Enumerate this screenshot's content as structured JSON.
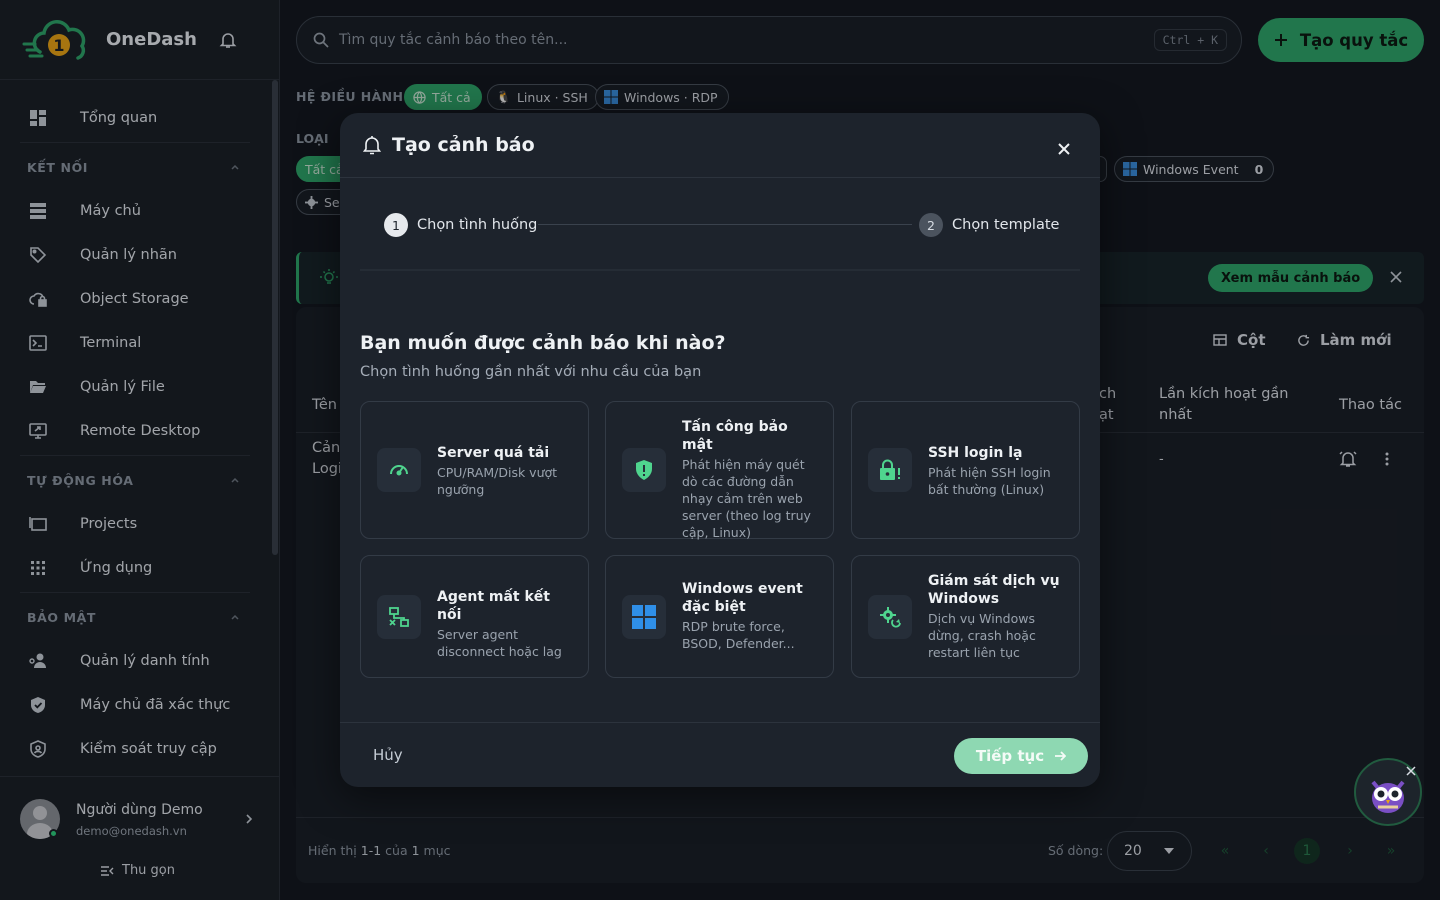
{
  "app": {
    "name": "OneDash"
  },
  "sidebar": {
    "top_item": "Tổng quan",
    "sections": [
      {
        "title": "KẾT NỐI",
        "items": [
          "Máy chủ",
          "Quản lý nhãn",
          "Object Storage",
          "Terminal",
          "Quản lý File",
          "Remote Desktop"
        ]
      },
      {
        "title": "TỰ ĐỘNG HÓA",
        "items": [
          "Projects",
          "Ứng dụng"
        ]
      },
      {
        "title": "BẢO MẬT",
        "items": [
          "Quản lý danh tính",
          "Máy chủ đã xác thực",
          "Kiểm soát truy cập"
        ]
      }
    ],
    "user": {
      "name": "Người dùng Demo",
      "email": "demo@onedash.vn"
    },
    "collapse_label": "Thu gọn"
  },
  "main": {
    "search_placeholder": "Tìm quy tắc cảnh báo theo tên...",
    "search_shortcut": "Ctrl + K",
    "create_button": "Tạo quy tắc",
    "os_filter": {
      "label": "HỆ ĐIỀU HÀNH",
      "chips": [
        "Tất cả",
        "Linux · SSH",
        "Windows · RDP"
      ]
    },
    "type_filter": {
      "label": "LOẠI",
      "chip_all": "Tất cả",
      "chip_partial": "Ser",
      "chip_windows_event": "Windows Event",
      "chip_windows_event_count": "0"
    },
    "tip": {
      "button": "Xem mẫu cảnh báo"
    },
    "toolbar": {
      "columns": "Cột",
      "refresh": "Làm mới"
    },
    "table": {
      "headers": {
        "name": "Tên",
        "partial_1": "ch",
        "partial_2": "ạt",
        "last_triggered_1": "Lần kích hoạt gần",
        "last_triggered_2": "nhất",
        "actions": "Thao tác"
      },
      "row": {
        "name_1": "Cản",
        "name_2": "Logi",
        "last_triggered": "-"
      }
    },
    "footer": {
      "showing_prefix": "Hiển thị",
      "showing_range": "1-1",
      "showing_of": "của",
      "showing_count": "1",
      "showing_suffix": "mục",
      "rows_label": "Số dòng:",
      "rows_value": "20",
      "current_page": "1"
    }
  },
  "modal": {
    "title": "Tạo cảnh báo",
    "steps": [
      {
        "num": "1",
        "label": "Chọn tình huống"
      },
      {
        "num": "2",
        "label": "Chọn template"
      }
    ],
    "question": "Bạn muốn được cảnh báo khi nào?",
    "question_sub": "Chọn tình huống gần nhất với nhu cầu của bạn",
    "cards": [
      {
        "title": "Server quá tải",
        "desc": "CPU/RAM/Disk vượt ngưỡng",
        "icon": "gauge-icon"
      },
      {
        "title": "Tấn công bảo mật",
        "desc": "Phát hiện máy quét dò các đường dẫn nhạy cảm trên web server (theo log truy cập, Linux)",
        "icon": "shield-alert-icon"
      },
      {
        "title": "SSH login lạ",
        "desc": "Phát hiện SSH login bất thường (Linux)",
        "icon": "lock-alert-icon"
      },
      {
        "title": "Agent mất kết nối",
        "desc": "Server agent disconnect hoặc lag",
        "icon": "network-off-icon"
      },
      {
        "title": "Windows event đặc biệt",
        "desc": "RDP brute force, BSOD, Defender...",
        "icon": "windows-icon"
      },
      {
        "title": "Giám sát dịch vụ Windows",
        "desc": "Dịch vụ Windows dừng, crash hoặc restart liên tục",
        "icon": "cog-sync-icon"
      }
    ],
    "cancel": "Hủy",
    "next": "Tiếp tục"
  },
  "colors": {
    "accent": "#2ea46a",
    "accent_light": "#8ed8b2",
    "background": "#141820",
    "surface": "#1d232c"
  }
}
